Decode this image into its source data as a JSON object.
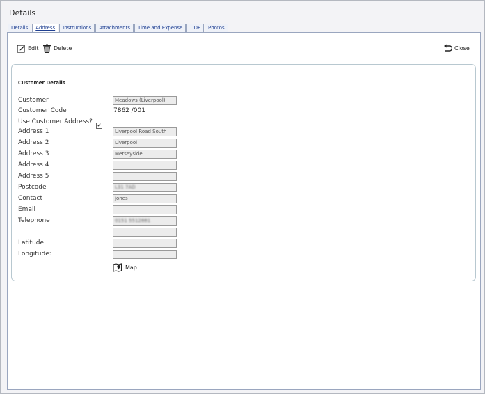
{
  "window": {
    "title": "Details"
  },
  "tabs": [
    {
      "label": "Details"
    },
    {
      "label": "Address"
    },
    {
      "label": "Instructions"
    },
    {
      "label": "Attachments"
    },
    {
      "label": "Time and Expense"
    },
    {
      "label": "UDF"
    },
    {
      "label": "Photos"
    }
  ],
  "active_tab": "Address",
  "toolbar": {
    "edit_label": "Edit",
    "delete_label": "Delete",
    "close_label": "Close"
  },
  "section_title": "Customer Details",
  "fields": {
    "customer": {
      "label": "Customer",
      "value": "Meadows (Liverpool)"
    },
    "customer_code": {
      "label": "Customer Code",
      "value": "7862 /001"
    },
    "use_customer_address": {
      "label": "Use Customer Address?",
      "checked": true,
      "glyph": "✔"
    },
    "address1": {
      "label": "Address 1",
      "value": "Liverpool Road South"
    },
    "address2": {
      "label": "Address 2",
      "value": "Liverpool"
    },
    "address3": {
      "label": "Address 3",
      "value": "Merseyside"
    },
    "address4": {
      "label": "Address 4",
      "value": ""
    },
    "address5": {
      "label": "Address 5",
      "value": ""
    },
    "postcode": {
      "label": "Postcode",
      "value": "L31 7AD"
    },
    "contact": {
      "label": "Contact",
      "value": "jones"
    },
    "email": {
      "label": "Email",
      "value": ""
    },
    "telephone": {
      "label": "Telephone",
      "value": "0151 5512881"
    },
    "telephone2": {
      "value": ""
    },
    "latitude": {
      "label": "Latitude:",
      "value": ""
    },
    "longitude": {
      "label": "Longitude:",
      "value": ""
    }
  },
  "map_button": {
    "label": "Map"
  },
  "icons": {
    "edit": "edit-icon",
    "delete": "trash-icon",
    "close": "undo-arrow-icon",
    "map": "map-pin-icon"
  }
}
